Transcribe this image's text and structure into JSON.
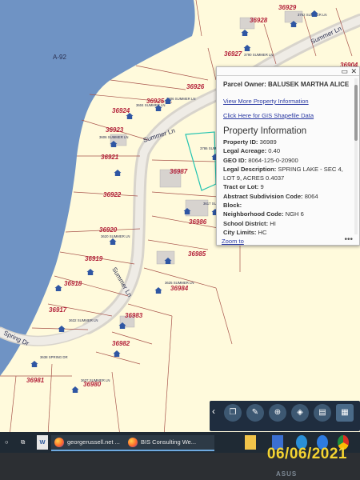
{
  "map": {
    "area_label": "A-92",
    "road_labels": [
      "Summer Ln",
      "Summer Ln",
      "Summer Ln",
      "Spring Dr"
    ],
    "lots": [
      {
        "number": "36929"
      },
      {
        "number": "36928"
      },
      {
        "number": "36927"
      },
      {
        "number": "36904"
      },
      {
        "number": "36926"
      },
      {
        "number": "36925"
      },
      {
        "number": "36924"
      },
      {
        "number": "36923"
      },
      {
        "number": "36921"
      },
      {
        "number": "36922"
      },
      {
        "number": "36987"
      },
      {
        "number": "36986"
      },
      {
        "number": "36920"
      },
      {
        "number": "36919"
      },
      {
        "number": "36985"
      },
      {
        "number": "36918"
      },
      {
        "number": "36984"
      },
      {
        "number": "36917"
      },
      {
        "number": "36983"
      },
      {
        "number": "36982"
      },
      {
        "number": "36981"
      },
      {
        "number": "36980"
      }
    ],
    "addresses": [
      "3762 SUMMER LN",
      "3790 SUMMER LN",
      "3606 SUMMER LN",
      "3604 SUMMER LN",
      "3606 SUMMER LN",
      "3786 SUMM",
      "3617 SUMMER",
      "3620 SUMMER LN",
      "3625 SUMMER LN",
      "3632 SUMMER LN",
      "3638 SPRING DR",
      "3637 SUMMER LN"
    ]
  },
  "popup": {
    "owner_label": "Parcel Owner: BALUSEK MARTHA ALICE",
    "link_details": "View More Property Information",
    "link_gis": "Click Here for GIS Shapefile Data",
    "section_title": "Property Information",
    "fields": [
      {
        "label": "Property ID:",
        "value": "36989"
      },
      {
        "label": "Legal Acreage:",
        "value": "0.40"
      },
      {
        "label": "GEO ID:",
        "value": "8064-125-0-20900"
      },
      {
        "label": "Legal Description:",
        "value": "SPRING LAKE - SEC 4, LOT 9, ACRES 0.4037"
      },
      {
        "label": "Tract or Lot:",
        "value": "9"
      },
      {
        "label": "Abstract Subdivision Code:",
        "value": "8064"
      },
      {
        "label": "Block:",
        "value": ""
      },
      {
        "label": "Neighborhood Code:",
        "value": "NGH 6"
      },
      {
        "label": "School District:",
        "value": "HI"
      },
      {
        "label": "City Limits:",
        "value": "HC"
      }
    ],
    "zoom_to": "Zoom to",
    "more": "•••",
    "window_ctrl_1": "▭",
    "window_ctrl_2": "✕"
  },
  "toolbar": {
    "tools": [
      "bookmark-icon",
      "pen-icon",
      "zoom-select-icon",
      "layers-icon",
      "print-icon",
      "grid-icon"
    ]
  },
  "taskbar": {
    "items": [
      {
        "label": "georgerussell.net ..."
      },
      {
        "label": "BIS Consulting We..."
      }
    ]
  },
  "overlay": {
    "date_stamp": "06/06/2021",
    "brand": "ASUS"
  },
  "colors": {
    "water": "#6f93c4",
    "land": "#fffadc",
    "lot_label": "#b3223a",
    "parcel_line": "#a8544b",
    "road": "#d8d4cc",
    "date_stamp": "#f5d431"
  }
}
